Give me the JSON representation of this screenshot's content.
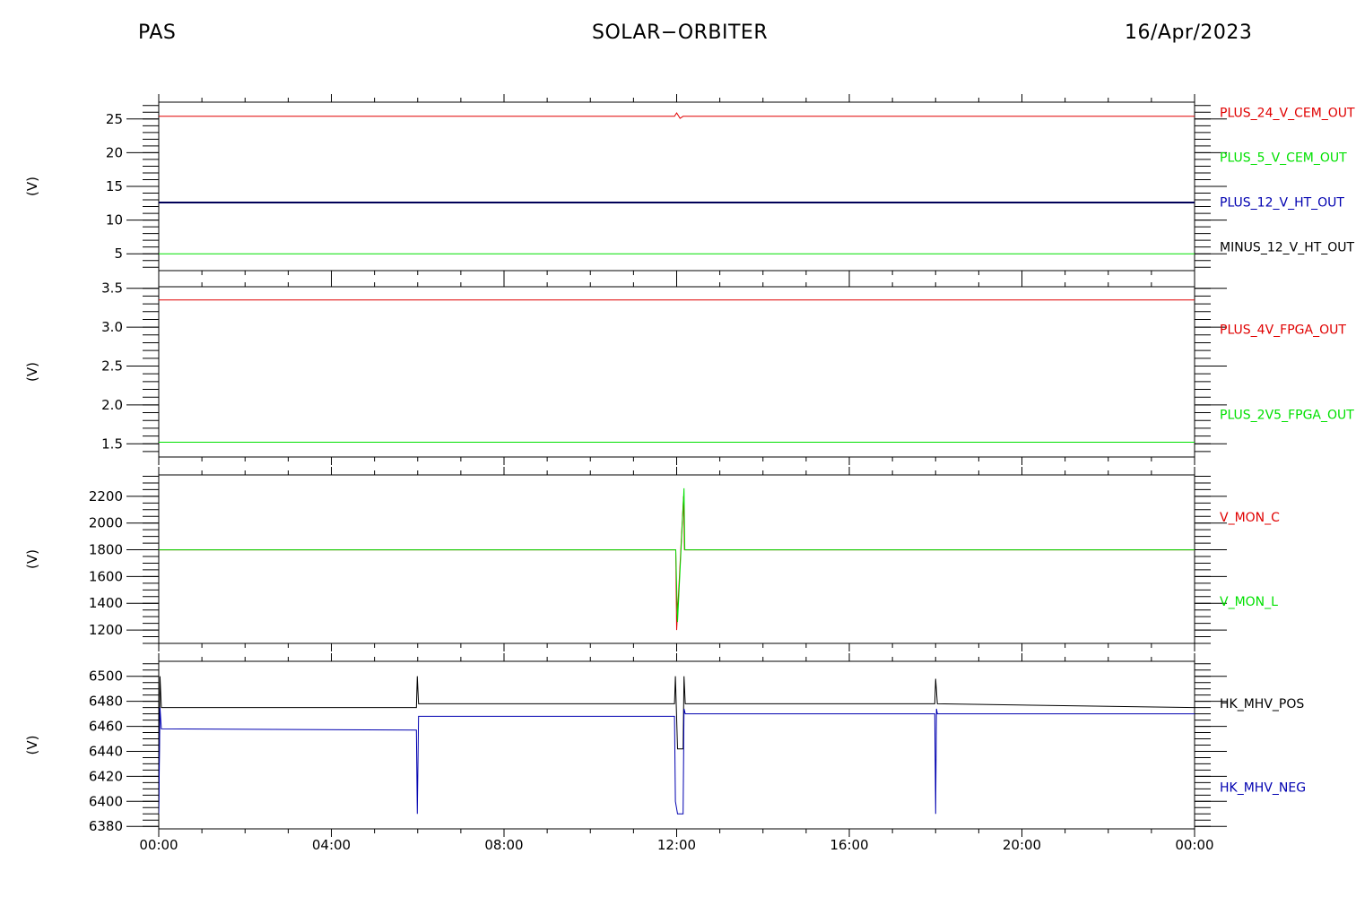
{
  "header": {
    "left": "PAS",
    "center": "SOLAR−ORBITER",
    "right": "16/Apr/2023"
  },
  "x_axis": {
    "tick_labels": [
      "00:00",
      "04:00",
      "08:00",
      "12:00",
      "16:00",
      "20:00",
      "00:00"
    ],
    "range_hours": [
      0,
      24
    ],
    "major_step_hours": 4,
    "minor_step_hours": 1
  },
  "colors": {
    "red": "#e00000",
    "green": "#00e000",
    "blue": "#0000b0",
    "black": "#000000"
  },
  "chart_data": [
    {
      "type": "line",
      "ylabel": "(V)",
      "ylim": [
        2.5,
        27.5
      ],
      "yticks": [
        5,
        10,
        15,
        20,
        25
      ],
      "yminor": 1,
      "legend_placement": "right",
      "series": [
        {
          "name": "PLUS_24_V_CEM_OUT",
          "color": "#e00000",
          "width": 1,
          "points": [
            [
              0,
              25.4
            ],
            [
              11.95,
              25.4
            ],
            [
              12.0,
              25.9
            ],
            [
              12.08,
              25.1
            ],
            [
              12.15,
              25.4
            ],
            [
              24,
              25.4
            ]
          ]
        },
        {
          "name": "PLUS_5_V_CEM_OUT",
          "color": "#00e000",
          "width": 1,
          "points": [
            [
              0,
              5.0
            ],
            [
              24,
              5.0
            ]
          ]
        },
        {
          "name": "PLUS_12_V_HT_OUT",
          "color": "#0000b0",
          "width": 2,
          "points": [
            [
              0,
              12.6
            ],
            [
              24,
              12.6
            ]
          ]
        },
        {
          "name": "MINUS_12_V_HT_OUT",
          "color": "#000000",
          "width": 1,
          "points": [
            [
              0,
              12.6
            ],
            [
              24,
              12.6
            ]
          ]
        }
      ]
    },
    {
      "type": "line",
      "ylabel": "(V)",
      "ylim": [
        1.33,
        3.52
      ],
      "yticks": [
        1.5,
        2.0,
        2.5,
        3.0,
        3.5
      ],
      "yminor": 0.1,
      "legend_placement": "right",
      "series": [
        {
          "name": "PLUS_4V_FPGA_OUT",
          "color": "#e00000",
          "width": 1,
          "points": [
            [
              0,
              3.35
            ],
            [
              24,
              3.35
            ]
          ]
        },
        {
          "name": "PLUS_2V5_FPGA_OUT",
          "color": "#00e000",
          "width": 1,
          "points": [
            [
              0,
              1.52
            ],
            [
              24,
              1.52
            ]
          ]
        }
      ]
    },
    {
      "type": "line",
      "ylabel": "(V)",
      "ylim": [
        1100,
        2360
      ],
      "yticks": [
        1200,
        1400,
        1600,
        1800,
        2000,
        2200
      ],
      "yminor": 50,
      "legend_placement": "right",
      "series": [
        {
          "name": "V_MON_C",
          "color": "#e00000",
          "width": 1,
          "points": [
            [
              0,
              1800
            ],
            [
              11.98,
              1800
            ],
            [
              12.0,
              1200
            ],
            [
              12.16,
              2200
            ],
            [
              12.18,
              1800
            ],
            [
              24,
              1800
            ]
          ]
        },
        {
          "name": "V_MON_L",
          "color": "#00e000",
          "width": 1,
          "points": [
            [
              0,
              1800
            ],
            [
              11.98,
              1800
            ],
            [
              12.02,
              1260
            ],
            [
              12.17,
              2260
            ],
            [
              12.19,
              1800
            ],
            [
              24,
              1800
            ]
          ]
        }
      ]
    },
    {
      "type": "line",
      "ylabel": "(V)",
      "ylim": [
        6378,
        6512
      ],
      "yticks": [
        6380,
        6400,
        6420,
        6440,
        6460,
        6480,
        6500
      ],
      "yminor": 5,
      "legend_placement": "right",
      "series": [
        {
          "name": "HK_MHV_POS",
          "color": "#000000",
          "width": 1,
          "points": [
            [
              0,
              6390
            ],
            [
              0.03,
              6500
            ],
            [
              0.06,
              6475
            ],
            [
              5.97,
              6475
            ],
            [
              5.99,
              6500
            ],
            [
              6.02,
              6478
            ],
            [
              11.95,
              6478
            ],
            [
              11.97,
              6500
            ],
            [
              12.02,
              6442
            ],
            [
              12.15,
              6442
            ],
            [
              12.17,
              6500
            ],
            [
              12.2,
              6478
            ],
            [
              17.98,
              6478
            ],
            [
              18.0,
              6498
            ],
            [
              18.04,
              6478
            ],
            [
              24,
              6475
            ]
          ]
        },
        {
          "name": "HK_MHV_NEG",
          "color": "#0000b0",
          "width": 1,
          "points": [
            [
              0,
              6390
            ],
            [
              0.03,
              6475
            ],
            [
              0.06,
              6458
            ],
            [
              5.97,
              6457
            ],
            [
              5.99,
              6390
            ],
            [
              6.02,
              6468
            ],
            [
              11.95,
              6468
            ],
            [
              11.97,
              6400
            ],
            [
              12.02,
              6390
            ],
            [
              12.15,
              6390
            ],
            [
              12.17,
              6474
            ],
            [
              12.2,
              6470
            ],
            [
              17.98,
              6470
            ],
            [
              18.0,
              6390
            ],
            [
              18.02,
              6474
            ],
            [
              18.04,
              6470
            ],
            [
              24,
              6470
            ]
          ]
        }
      ]
    }
  ]
}
